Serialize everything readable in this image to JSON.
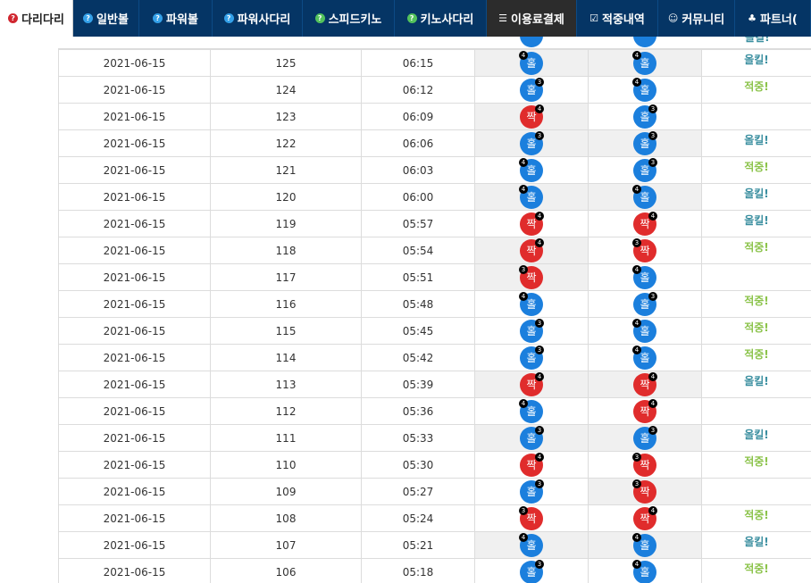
{
  "nav": {
    "tabs": [
      {
        "label": "다리다리",
        "icon": "question-icon",
        "color": "red",
        "active": true,
        "width": 82
      },
      {
        "label": "일반볼",
        "icon": "question-icon",
        "color": "blue",
        "width": 74
      },
      {
        "label": "파워볼",
        "icon": "question-icon",
        "color": "blue",
        "width": 82
      },
      {
        "label": "파워사다리",
        "icon": "question-icon",
        "color": "blue",
        "width": 101
      },
      {
        "label": "스피드키노",
        "icon": "question-icon",
        "color": "green",
        "width": 103
      },
      {
        "label": "키노사다리",
        "icon": "question-icon",
        "color": "green",
        "width": 103
      },
      {
        "label": "이용료결제",
        "icon": "database-icon",
        "color": "plain",
        "dark": true,
        "width": 101
      },
      {
        "label": "적중내역",
        "icon": "checkbox-icon",
        "color": "plain",
        "width": 91
      },
      {
        "label": "커뮤니티",
        "icon": "smile-icon",
        "color": "plain",
        "width": 86
      },
      {
        "label": "파트너(",
        "icon": "users-icon",
        "color": "plain",
        "width": 85
      }
    ]
  },
  "rows": [
    {
      "date": "2021-06-15",
      "no": "125",
      "time": "06:15",
      "b1": {
        "t": "홀",
        "n": "4",
        "side": "left",
        "kind": "odd"
      },
      "b2": {
        "t": "홀",
        "n": "4",
        "side": "left",
        "kind": "odd"
      },
      "res": "올킬!",
      "rk": "win",
      "g1": true,
      "g2": true
    },
    {
      "date": "2021-06-15",
      "no": "124",
      "time": "06:12",
      "b1": {
        "t": "홀",
        "n": "3",
        "side": "right",
        "kind": "odd"
      },
      "b2": {
        "t": "홀",
        "n": "4",
        "side": "left",
        "kind": "odd"
      },
      "res": "적중!",
      "rk": "hit",
      "g1": false,
      "g2": false
    },
    {
      "date": "2021-06-15",
      "no": "123",
      "time": "06:09",
      "b1": {
        "t": "짝",
        "n": "4",
        "side": "right",
        "kind": "even"
      },
      "b2": {
        "t": "홀",
        "n": "3",
        "side": "right",
        "kind": "odd"
      },
      "res": "",
      "rk": "win",
      "g1": true,
      "g2": false
    },
    {
      "date": "2021-06-15",
      "no": "122",
      "time": "06:06",
      "b1": {
        "t": "홀",
        "n": "3",
        "side": "right",
        "kind": "odd"
      },
      "b2": {
        "t": "홀",
        "n": "3",
        "side": "right",
        "kind": "odd"
      },
      "res": "올킬!",
      "rk": "win",
      "g1": true,
      "g2": true
    },
    {
      "date": "2021-06-15",
      "no": "121",
      "time": "06:03",
      "b1": {
        "t": "홀",
        "n": "4",
        "side": "left",
        "kind": "odd"
      },
      "b2": {
        "t": "홀",
        "n": "3",
        "side": "right",
        "kind": "odd"
      },
      "res": "적중!",
      "rk": "hit",
      "g1": false,
      "g2": false
    },
    {
      "date": "2021-06-15",
      "no": "120",
      "time": "06:00",
      "b1": {
        "t": "홀",
        "n": "4",
        "side": "left",
        "kind": "odd"
      },
      "b2": {
        "t": "홀",
        "n": "4",
        "side": "left",
        "kind": "odd"
      },
      "res": "올킬!",
      "rk": "win",
      "g1": true,
      "g2": true
    },
    {
      "date": "2021-06-15",
      "no": "119",
      "time": "05:57",
      "b1": {
        "t": "짝",
        "n": "4",
        "side": "right",
        "kind": "even"
      },
      "b2": {
        "t": "짝",
        "n": "4",
        "side": "right",
        "kind": "even"
      },
      "res": "올킬!",
      "rk": "win",
      "g1": false,
      "g2": false
    },
    {
      "date": "2021-06-15",
      "no": "118",
      "time": "05:54",
      "b1": {
        "t": "짝",
        "n": "4",
        "side": "right",
        "kind": "even"
      },
      "b2": {
        "t": "짝",
        "n": "3",
        "side": "left",
        "kind": "even"
      },
      "res": "적중!",
      "rk": "hit",
      "g1": true,
      "g2": false
    },
    {
      "date": "2021-06-15",
      "no": "117",
      "time": "05:51",
      "b1": {
        "t": "짝",
        "n": "3",
        "side": "left",
        "kind": "even"
      },
      "b2": {
        "t": "홀",
        "n": "4",
        "side": "left",
        "kind": "odd"
      },
      "res": "",
      "rk": "win",
      "g1": true,
      "g2": false
    },
    {
      "date": "2021-06-15",
      "no": "116",
      "time": "05:48",
      "b1": {
        "t": "홀",
        "n": "4",
        "side": "left",
        "kind": "odd"
      },
      "b2": {
        "t": "홀",
        "n": "3",
        "side": "right",
        "kind": "odd"
      },
      "res": "적중!",
      "rk": "hit",
      "g1": false,
      "g2": false
    },
    {
      "date": "2021-06-15",
      "no": "115",
      "time": "05:45",
      "b1": {
        "t": "홀",
        "n": "3",
        "side": "right",
        "kind": "odd"
      },
      "b2": {
        "t": "홀",
        "n": "4",
        "side": "left",
        "kind": "odd"
      },
      "res": "적중!",
      "rk": "hit",
      "g1": false,
      "g2": false
    },
    {
      "date": "2021-06-15",
      "no": "114",
      "time": "05:42",
      "b1": {
        "t": "홀",
        "n": "3",
        "side": "right",
        "kind": "odd"
      },
      "b2": {
        "t": "홀",
        "n": "4",
        "side": "left",
        "kind": "odd"
      },
      "res": "적중!",
      "rk": "hit",
      "g1": false,
      "g2": false
    },
    {
      "date": "2021-06-15",
      "no": "113",
      "time": "05:39",
      "b1": {
        "t": "짝",
        "n": "4",
        "side": "right",
        "kind": "even"
      },
      "b2": {
        "t": "짝",
        "n": "4",
        "side": "right",
        "kind": "even"
      },
      "res": "올킬!",
      "rk": "win",
      "g1": true,
      "g2": true
    },
    {
      "date": "2021-06-15",
      "no": "112",
      "time": "05:36",
      "b1": {
        "t": "홀",
        "n": "4",
        "side": "left",
        "kind": "odd"
      },
      "b2": {
        "t": "짝",
        "n": "4",
        "side": "right",
        "kind": "even"
      },
      "res": "",
      "rk": "win",
      "g1": false,
      "g2": false
    },
    {
      "date": "2021-06-15",
      "no": "111",
      "time": "05:33",
      "b1": {
        "t": "홀",
        "n": "3",
        "side": "right",
        "kind": "odd"
      },
      "b2": {
        "t": "홀",
        "n": "3",
        "side": "right",
        "kind": "odd"
      },
      "res": "올킬!",
      "rk": "win",
      "g1": true,
      "g2": true
    },
    {
      "date": "2021-06-15",
      "no": "110",
      "time": "05:30",
      "b1": {
        "t": "짝",
        "n": "4",
        "side": "right",
        "kind": "even"
      },
      "b2": {
        "t": "짝",
        "n": "3",
        "side": "left",
        "kind": "even"
      },
      "res": "적중!",
      "rk": "hit",
      "g1": false,
      "g2": false
    },
    {
      "date": "2021-06-15",
      "no": "109",
      "time": "05:27",
      "b1": {
        "t": "홀",
        "n": "3",
        "side": "right",
        "kind": "odd"
      },
      "b2": {
        "t": "짝",
        "n": "3",
        "side": "left",
        "kind": "even"
      },
      "res": "",
      "rk": "win",
      "g1": false,
      "g2": true
    },
    {
      "date": "2021-06-15",
      "no": "108",
      "time": "05:24",
      "b1": {
        "t": "짝",
        "n": "3",
        "side": "left",
        "kind": "even"
      },
      "b2": {
        "t": "짝",
        "n": "4",
        "side": "right",
        "kind": "even"
      },
      "res": "적중!",
      "rk": "hit",
      "g1": false,
      "g2": false
    },
    {
      "date": "2021-06-15",
      "no": "107",
      "time": "05:21",
      "b1": {
        "t": "홀",
        "n": "4",
        "side": "left",
        "kind": "odd"
      },
      "b2": {
        "t": "홀",
        "n": "4",
        "side": "left",
        "kind": "odd"
      },
      "res": "올킬!",
      "rk": "win",
      "g1": true,
      "g2": true
    },
    {
      "date": "2021-06-15",
      "no": "106",
      "time": "05:18",
      "b1": {
        "t": "홀",
        "n": "3",
        "side": "right",
        "kind": "odd"
      },
      "b2": {
        "t": "홀",
        "n": "4",
        "side": "left",
        "kind": "odd"
      },
      "res": "적중!",
      "rk": "hit",
      "g1": false,
      "g2": false
    }
  ],
  "colors": {
    "nav_bg": "#053565",
    "odd": "#1b7fdd",
    "even": "#e02c2c",
    "win": "#3b8fa0",
    "hit": "#8bc34a"
  }
}
